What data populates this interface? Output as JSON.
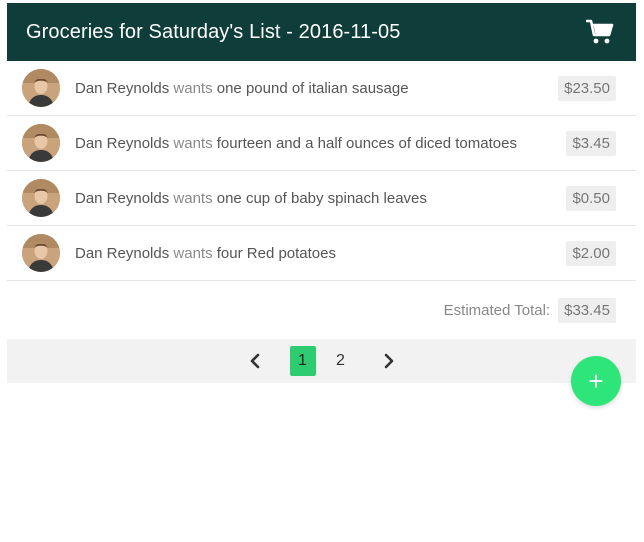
{
  "header": {
    "title": "Groceries for Saturday's List - 2016-11-05",
    "icon": "shopping-cart-icon"
  },
  "items": [
    {
      "who": "Dan Reynolds",
      "verb": "wants",
      "item": "one pound of italian sausage",
      "price": "$23.50"
    },
    {
      "who": "Dan Reynolds",
      "verb": "wants",
      "item": "fourteen and a half ounces of diced tomatoes",
      "price": "$3.45"
    },
    {
      "who": "Dan Reynolds",
      "verb": "wants",
      "item": "one cup of baby spinach leaves",
      "price": "$0.50"
    },
    {
      "who": "Dan Reynolds",
      "verb": "wants",
      "item": "four Red potatoes",
      "price": "$2.00"
    }
  ],
  "total": {
    "label": "Estimated Total:",
    "value": "$33.45"
  },
  "pagination": {
    "prev_icon": "chevron-left-icon",
    "next_icon": "chevron-right-icon",
    "pages": [
      "1",
      "2"
    ],
    "active": "1"
  },
  "fab": {
    "label": "+"
  },
  "colors": {
    "header_bg": "#0f3d3a",
    "accent": "#2ecc71",
    "fab": "#2ee57a"
  }
}
